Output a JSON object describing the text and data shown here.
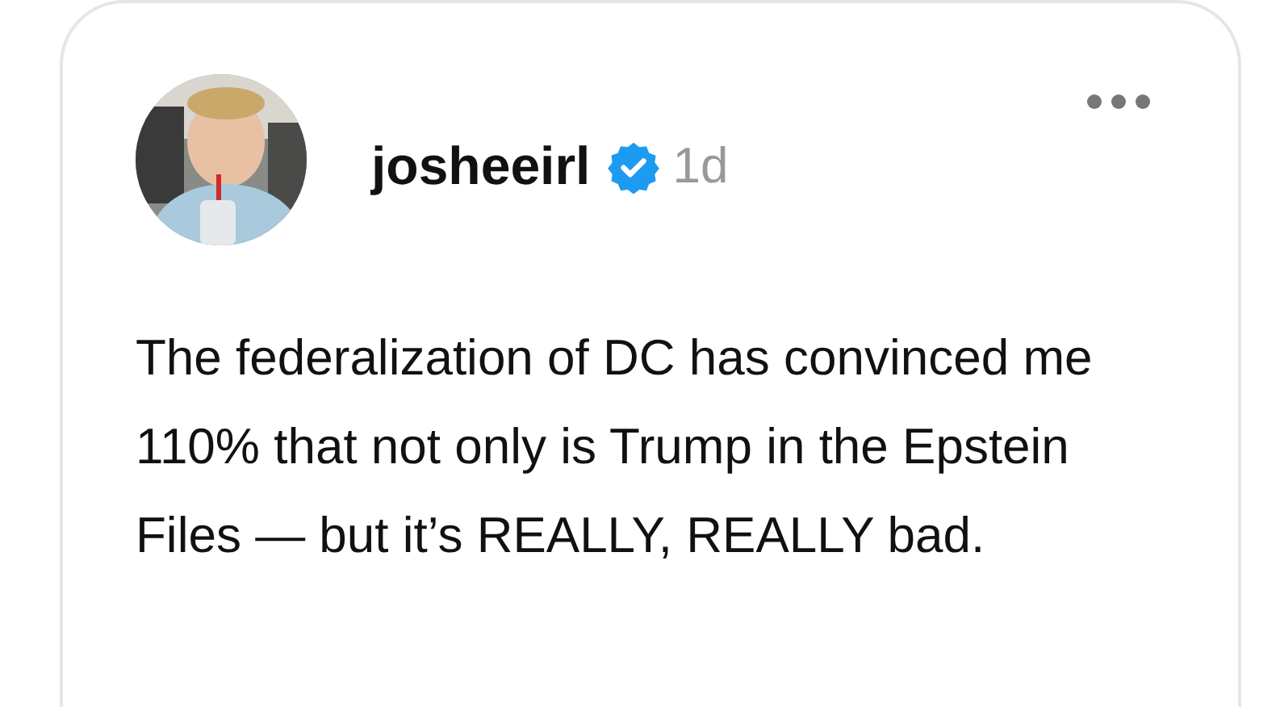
{
  "post": {
    "author": {
      "username": "josheeirl",
      "verified": true
    },
    "time": "1d",
    "text": "The federalization of DC has convinced me 110% that not only is Trump in the Epstein Files — but it’s REALLY, REALLY bad."
  }
}
